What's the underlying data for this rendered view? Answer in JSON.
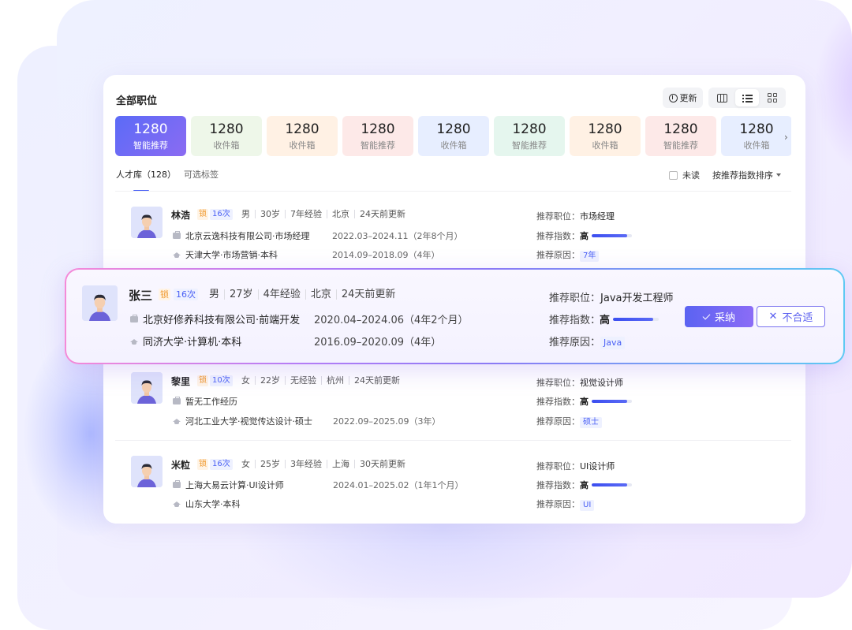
{
  "header": {
    "title": "全部职位",
    "refresh_label": "更新",
    "icons": [
      "refresh-icon",
      "columns-view-icon",
      "list-view-icon",
      "grid-view-icon"
    ]
  },
  "tiles": [
    {
      "count": "1280",
      "label": "智能推荐",
      "active": true
    },
    {
      "count": "1280",
      "label": "收件箱",
      "color": "#eef7e9"
    },
    {
      "count": "1280",
      "label": "收件箱",
      "color": "#fff1e4"
    },
    {
      "count": "1280",
      "label": "智能推荐",
      "color": "#fde9e8"
    },
    {
      "count": "1280",
      "label": "收件箱",
      "color": "#e7eeff"
    },
    {
      "count": "1280",
      "label": "智能推荐",
      "color": "#e5f6ee"
    },
    {
      "count": "1280",
      "label": "收件箱",
      "color": "#fff1e4"
    },
    {
      "count": "1280",
      "label": "智能推荐",
      "color": "#fde9e8"
    },
    {
      "count": "1280",
      "label": "收件箱",
      "color": "#e7eeff"
    }
  ],
  "filters": {
    "tab_main": "人才库（128）",
    "tab_second": "可选标签",
    "unread_label": "未读",
    "sort_label": "按推荐指数排序"
  },
  "candidates": [
    {
      "name": "林浩",
      "lock": "锁",
      "count": "16次",
      "meta": [
        "男",
        "30岁",
        "7年经验",
        "北京",
        "24天前更新"
      ],
      "work": "北京云逸科技有限公司·市场经理",
      "work_period": "2022.03–2024.11（2年8个月）",
      "edu": "天津大学·市场营销·本科",
      "edu_period": "2014.09–2018.09（4年）",
      "rec_position_label": "推荐职位：",
      "rec_position": "市场经理",
      "rec_index_label": "推荐指数：",
      "rec_index": "高",
      "rec_level": 0.88,
      "rec_reason_label": "推荐原因：",
      "rec_reason": "7年"
    },
    {
      "name": "张三",
      "lock": "锁",
      "count": "16次",
      "meta": [
        "男",
        "27岁",
        "4年经验",
        "北京",
        "24天前更新"
      ],
      "work": "北京好修养科技有限公司·前端开发",
      "work_period": "2020.04–2024.06（4年2个月）",
      "edu": "同济大学·计算机·本科",
      "edu_period": "2016.09–2020.09（4年）",
      "rec_position_label": "推荐职位：",
      "rec_position": "Java开发工程师",
      "rec_index_label": "推荐指数：",
      "rec_index": "高",
      "rec_level": 0.88,
      "rec_reason_label": "推荐原因：",
      "rec_reason": "Java",
      "accept_label": "采纳",
      "reject_label": "不合适"
    },
    {
      "name": "黎里",
      "lock": "锁",
      "count": "10次",
      "meta": [
        "女",
        "22岁",
        "无经验",
        "杭州",
        "24天前更新"
      ],
      "work": "暂无工作经历",
      "work_period": "",
      "edu": "河北工业大学·视觉传达设计·硕士",
      "edu_period": "2022.09–2025.09（3年）",
      "rec_position_label": "推荐职位：",
      "rec_position": "视觉设计师",
      "rec_index_label": "推荐指数：",
      "rec_index": "高",
      "rec_level": 0.88,
      "rec_reason_label": "推荐原因：",
      "rec_reason": "硕士"
    },
    {
      "name": "米粒",
      "lock": "锁",
      "count": "16次",
      "meta": [
        "女",
        "25岁",
        "3年经验",
        "上海",
        "30天前更新"
      ],
      "work": "上海大易云计算·UI设计师",
      "work_period": "2024.01–2025.02（1年1个月）",
      "edu": "山东大学·本科",
      "edu_period": "",
      "rec_position_label": "推荐职位：",
      "rec_position": "UI设计师",
      "rec_index_label": "推荐指数：",
      "rec_index": "高",
      "rec_level": 0.88,
      "rec_reason_label": "推荐原因：",
      "rec_reason": "UI"
    }
  ],
  "colors": {
    "accent": "#4a60f5",
    "active_tile_start": "#5b6bf7",
    "active_tile_end": "#8b6bf2",
    "lock_tag": "#f0992e"
  }
}
